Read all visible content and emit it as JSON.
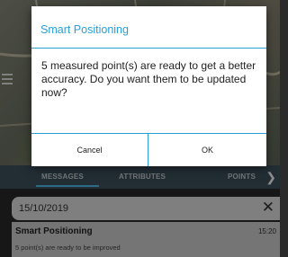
{
  "dialog": {
    "title": "Smart Positioning",
    "message": "5 measured point(s) are ready to get a better accuracy. Do you want them to be updated now?",
    "cancel_label": "Cancel",
    "ok_label": "OK"
  },
  "tabs": [
    {
      "label": "MESSAGES"
    },
    {
      "label": "ATTRIBUTES"
    },
    {
      "label": "POINTS"
    }
  ],
  "notification": {
    "date": "15/10/2019",
    "title": "Smart Positioning",
    "time": "15:20",
    "subtitle": "5 point(s) are ready to be improved"
  },
  "colors": {
    "accent": "#2a9fd6",
    "tab_bar": "#3f5260"
  },
  "icons": {
    "menu": "hamburger-menu-icon",
    "next_tab": "chevron-right-icon",
    "close": "close-icon"
  }
}
